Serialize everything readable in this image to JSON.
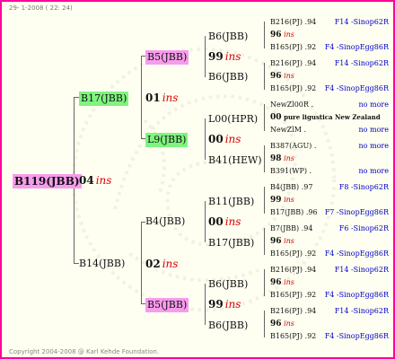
{
  "header": "29- 1-2008 ( 22: 24)",
  "footer": "Copyright 2004-2008 @ Karl Kehde Foundation.",
  "root": "B119(JBB)",
  "root_gen": {
    "num": "04",
    "ins": "ins"
  },
  "g1": [
    {
      "label": "B17(JBB)",
      "gen": {
        "num": "01",
        "ins": "ins"
      }
    },
    {
      "label": "B14(JBB)",
      "gen": {
        "num": "02",
        "ins": "ins"
      }
    }
  ],
  "g2": [
    {
      "label": "B5(JBB)",
      "gen": {
        "num": "99",
        "ins": "ins"
      }
    },
    {
      "label": "L9(JBB)",
      "gen": {
        "num": "00",
        "ins": "ins"
      }
    },
    {
      "label": "B4(JBB)",
      "gen": {
        "num": "00",
        "ins": "ins"
      }
    },
    {
      "label": "B5(JBB)",
      "gen": {
        "num": "99",
        "ins": "ins"
      }
    }
  ],
  "g3": [
    {
      "label": "B6(JBB)",
      "gen": {
        "num": "96",
        "ins": "ins"
      }
    },
    {
      "label": "B6(JBB)",
      "gen": {
        "num": "96",
        "ins": "ins"
      }
    },
    {
      "label": "L00(HPR)",
      "gen": {
        "num": "00",
        "ins": "pure ligustica New Zealand"
      }
    },
    {
      "label": "B41(HEW)",
      "gen": {
        "num": "98",
        "ins": "ins"
      }
    },
    {
      "label": "B11(JBB)",
      "gen": {
        "num": "99",
        "ins": "ins"
      }
    },
    {
      "label": "B17(JBB)",
      "gen": {
        "num": "96",
        "ins": "ins"
      }
    },
    {
      "label": "B6(JBB)",
      "gen": {
        "num": "96",
        "ins": "ins"
      }
    },
    {
      "label": "B6(JBB)",
      "gen": {
        "num": "96",
        "ins": "ins"
      }
    }
  ],
  "g4": [
    {
      "l": "B216(PJ)",
      "v": ".94",
      "r": "F14 -Sinop62R"
    },
    {
      "l": "B165(PJ)",
      "v": ".92",
      "r": "F4 -SinopEgg86R"
    },
    {
      "l": "B216(PJ)",
      "v": ".94",
      "r": "F14 -Sinop62R"
    },
    {
      "l": "B165(PJ)",
      "v": ".92",
      "r": "F4 -SinopEgg86R"
    },
    {
      "l": "NewZl00R",
      "v": ".",
      "r": "no more"
    },
    {
      "l": "NewZlM",
      "v": ".",
      "r": "no more"
    },
    {
      "l": "B387(AGU)",
      "v": ".",
      "r": "no more"
    },
    {
      "l": "B391(WP)",
      "v": ".",
      "r": "no more"
    },
    {
      "l": "B4(JBB)",
      "v": ".97",
      "r": "F8 -Sinop62R"
    },
    {
      "l": "B17(JBB)",
      "v": ".96",
      "r": "F7 -SinopEgg86R"
    },
    {
      "l": "B7(JBB)",
      "v": ".94",
      "r": "F6 -Sinop62R"
    },
    {
      "l": "B165(PJ)",
      "v": ".92",
      "r": "F4 -SinopEgg86R"
    },
    {
      "l": "B216(PJ)",
      "v": ".94",
      "r": "F14 -Sinop62R"
    },
    {
      "l": "B165(PJ)",
      "v": ".92",
      "r": "F4 -SinopEgg86R"
    },
    {
      "l": "B216(PJ)",
      "v": ".94",
      "r": "F14 -Sinop62R"
    },
    {
      "l": "B165(PJ)",
      "v": ".92",
      "r": "F4 -SinopEgg86R"
    }
  ]
}
